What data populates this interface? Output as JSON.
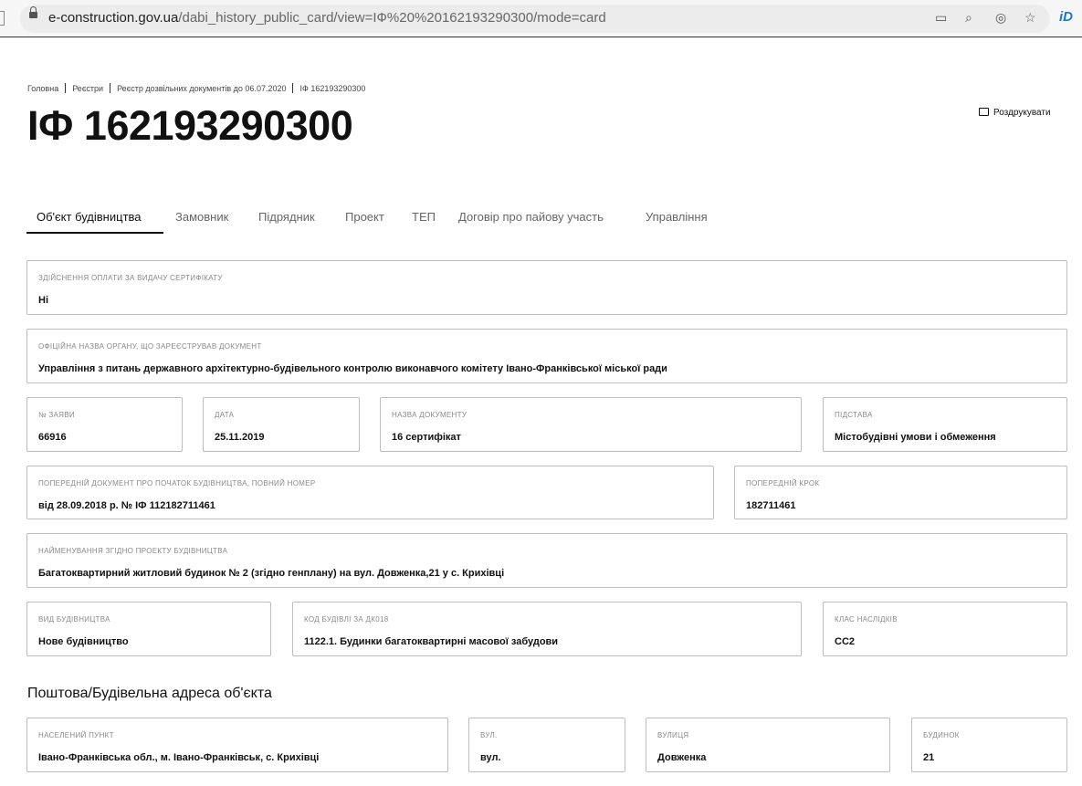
{
  "browser": {
    "url_host": "e-construction.gov.ua",
    "url_path": "/dabi_history_public_card/view=IФ%20%20162193290300/mode=card",
    "ext_label": "iD"
  },
  "breadcrumb": [
    "Головна",
    "Реєстри",
    "Реєстр дозвільних документів до 06.07.2020",
    "ІФ 162193290300"
  ],
  "page_title": "ІФ 162193290300",
  "print_label": "Роздрукувати",
  "tabs": [
    "Об'єкт будівництва",
    "Замовник",
    "Підрядник",
    "Проект",
    "ТЕП",
    "Договір про пайову участь",
    "Управління"
  ],
  "active_tab": "Об'єкт будівництва",
  "fields": {
    "payment": {
      "label": "Здійснення оплати за видачу сертифікату",
      "value": "Ні"
    },
    "authority": {
      "label": "Офіційна назва органу, що зареєстрував документ",
      "value": "Управління з питань державного архітектурно-будівельного контролю виконавчого комітету Івано-Франківської міської ради"
    },
    "app_no": {
      "label": "№ заяви",
      "value": "66916"
    },
    "date": {
      "label": "Дата",
      "value": "25.11.2019"
    },
    "doc_name": {
      "label": "Назва документу",
      "value": "16 сертифікат"
    },
    "basis": {
      "label": "Підстава",
      "value": "Містобудівні умови і обмеження"
    },
    "prev_doc": {
      "label": "Попередній документ про початок будівництва, повний номер",
      "value": "від 28.09.2018 р. № ІФ 112182711461"
    },
    "prev_step": {
      "label": "Попередній крок",
      "value": "182711461"
    },
    "project_name": {
      "label": "Найменування згідно проекту будівництва",
      "value": "Багатоквартирний житловий будинок № 2 (згідно генплану) на вул. Довженка,21 у с. Крихівці"
    },
    "build_type": {
      "label": "Вид будівництва",
      "value": "Нове будівництво"
    },
    "building_code": {
      "label": "Код будівлі за ДК018",
      "value": "1122.1. Будинки багатоквартирні масової забудови"
    },
    "consequence_class": {
      "label": "Клас наслідків",
      "value": "СС2"
    }
  },
  "address_section": {
    "title": "Поштова/Будівельна адреса об'єкта",
    "locality": {
      "label": "Населений пункт",
      "value": "Івано-Франківська обл., м. Івано-Франківськ, с. Крихівці"
    },
    "street_type": {
      "label": "Вул.",
      "value": "вул."
    },
    "street": {
      "label": "Вулиця",
      "value": "Довженка"
    },
    "house": {
      "label": "Будинок",
      "value": "21"
    }
  }
}
